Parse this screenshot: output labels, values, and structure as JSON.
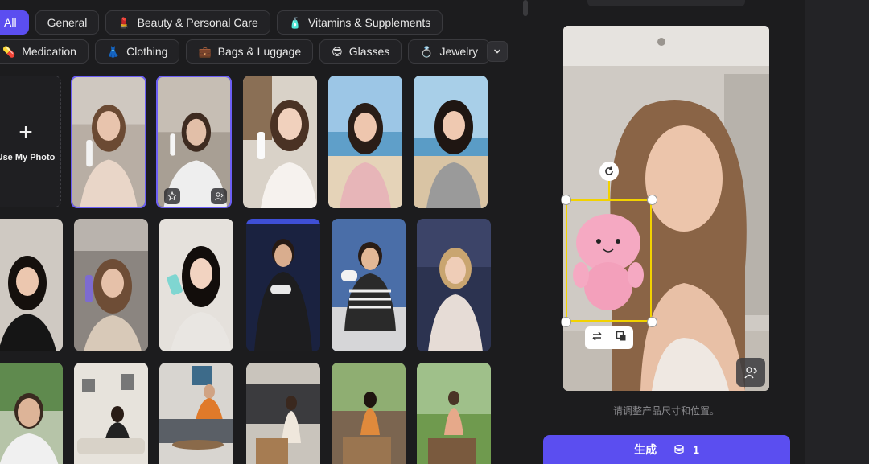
{
  "categories_row1": [
    {
      "label": "All",
      "icon": "none",
      "active": true
    },
    {
      "label": "General",
      "icon": "none"
    },
    {
      "label": "Beauty & Personal Care",
      "icon": "lipstick-icon",
      "glyph": "💄"
    },
    {
      "label": "Vitamins & Supplements",
      "icon": "bottle-icon",
      "glyph": "🧴"
    }
  ],
  "categories_row2": [
    {
      "label": "Medication",
      "icon": "pill-icon",
      "glyph": "💊"
    },
    {
      "label": "Clothing",
      "icon": "dress-icon",
      "glyph": "👗"
    },
    {
      "label": "Bags & Luggage",
      "icon": "briefcase-icon",
      "glyph": "💼"
    },
    {
      "label": "Glasses",
      "icon": "sunglasses-face-icon",
      "glyph": "😎"
    },
    {
      "label": "Jewelry",
      "icon": "ring-icon",
      "glyph": "💍"
    }
  ],
  "upload": {
    "plus": "+",
    "label": "Use My Photo"
  },
  "preview": {
    "hint": "请调整产品尺寸和位置。"
  },
  "generate": {
    "label": "生成",
    "credits": "1"
  },
  "colors": {
    "accent": "#5b4ef0",
    "selection": "#f2d200",
    "bg": "#1c1c1e"
  }
}
